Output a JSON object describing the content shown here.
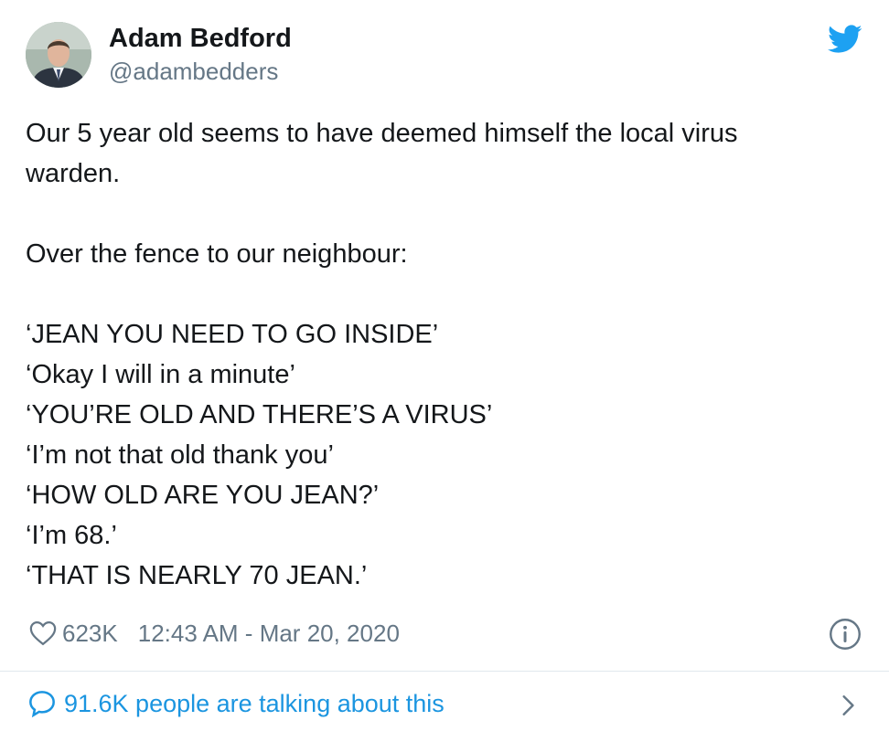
{
  "author": {
    "name": "Adam Bedford",
    "handle": "@adambedders",
    "avatar_icon": "profile-photo"
  },
  "brand": {
    "icon": "twitter-bird-icon",
    "color": "#1da1f2"
  },
  "tweet": {
    "text": "Our 5 year old seems to have deemed himself the local virus\nwarden.\n\nOver the fence to our neighbour:\n\n‘JEAN YOU NEED TO GO INSIDE’\n‘Okay I will in a minute’\n‘YOU’RE OLD AND THERE’S A VIRUS’\n‘I’m not that old thank you’\n‘HOW OLD ARE YOU JEAN?’\n‘I’m 68.’\n‘THAT IS NEARLY 70 JEAN.’"
  },
  "meta": {
    "likes": "623K",
    "timestamp": "12:43 AM - Mar 20, 2020"
  },
  "footer": {
    "talking": "91.6K people are talking about this",
    "accent": "#1b95e0"
  }
}
